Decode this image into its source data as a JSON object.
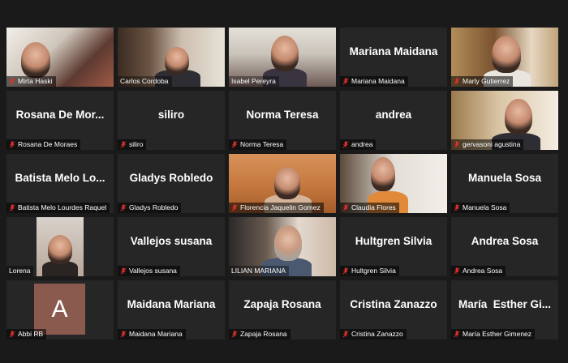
{
  "avatar_letter": "A",
  "colors": {
    "active_speaker": "#e4e84a",
    "muted_icon": "#e0302e",
    "tile_bg": "#262626"
  },
  "participants": [
    {
      "name": "Mirta Haski"
    },
    {
      "name": "Carlos Cordoba"
    },
    {
      "name": "Isabel Pereyra"
    },
    {
      "name": "Mariana Maidana",
      "display": "Mariana Maidana"
    },
    {
      "name": "Marly Gutierrez"
    },
    {
      "name": "Rosana De Moraes",
      "display": "Rosana De Mor..."
    },
    {
      "name": "siliro",
      "display": "siliro"
    },
    {
      "name": "Norma Teresa",
      "display": "Norma Teresa"
    },
    {
      "name": "andrea",
      "display": "andrea"
    },
    {
      "name": "gervasoni agustina"
    },
    {
      "name": "Batista Melo Lourdes Raquel",
      "display": "Batista Melo Lo..."
    },
    {
      "name": "Gladys Robledo",
      "display": "Gladys Robledo"
    },
    {
      "name": "Florencia Jaquelin Gomez"
    },
    {
      "name": "Claudia Flores"
    },
    {
      "name": "Manuela Sosa",
      "display": "Manuela Sosa"
    },
    {
      "name": "Lorena"
    },
    {
      "name": "Vallejos susana",
      "display": "Vallejos susana"
    },
    {
      "name": "LILIAN MARIANA"
    },
    {
      "name": "Hultgren Silvia",
      "display": "Hultgren Silvia"
    },
    {
      "name": "Andrea Sosa",
      "display": "Andrea Sosa"
    },
    {
      "name": "Abbi RB"
    },
    {
      "name": "Maidana Mariana",
      "display": "Maidana Mariana"
    },
    {
      "name": "Zapaja Rosana",
      "display": "Zapaja Rosana"
    },
    {
      "name": "Cristina Zanazzo",
      "display": "Cristina Zanazzo"
    },
    {
      "name": "María Esther Gimenez",
      "display": "María  Esther Gi..."
    }
  ]
}
